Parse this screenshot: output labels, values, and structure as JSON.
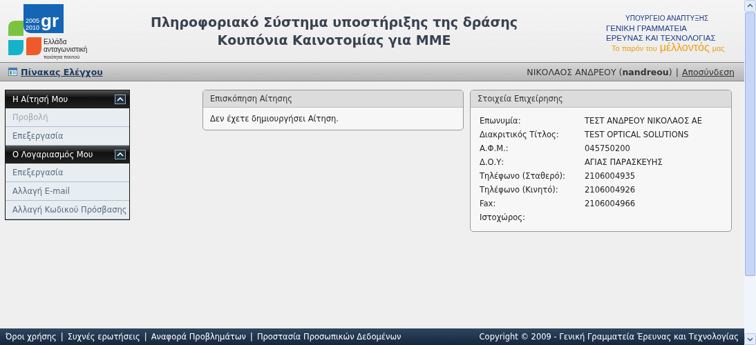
{
  "header": {
    "logo": {
      "mark": "gr",
      "years": [
        "2005",
        "2010"
      ],
      "lines": [
        "Ελλάδα",
        "ανταγωνιστική",
        "ποιότητα παντού"
      ]
    },
    "title": [
      "Πληροφοριακό Σύστημα υποστήριξης της δράσης",
      "Κουπόνια Καινοτομίας για ΜΜΕ"
    ],
    "ministry": [
      "ΥΠΟΥΡΓΕΙΟ ΑΝΑΠΤΥΞΗΣ",
      "ΓΕΝΙΚΗ ΓΡΑΜΜΑΤΕΙΑ",
      "ΕΡΕΥΝΑΣ ΚΑΙ ΤΕΧΝΟΛΟΓΙΑΣ"
    ],
    "slogan": [
      "Το παρόν του",
      "μέλλοντός",
      "μας"
    ]
  },
  "navbar": {
    "dashboard": "Πίνακας Ελέγχου",
    "user_name": "ΝΙΚΟΛΑΟΣ ΑΝΔΡΕΟΥ (**nandreou**)",
    "separator": "|",
    "logout": "Αποσύνδεση"
  },
  "sidebar": [
    {
      "title": "Η Αίτησή Μου",
      "expanded": true,
      "items": [
        {
          "label": "Προβολή",
          "disabled": true
        },
        {
          "label": "Επεξεργασία",
          "disabled": false
        }
      ]
    },
    {
      "title": "Ο Λογαριασμός Μου",
      "expanded": true,
      "items": [
        {
          "label": "Επεξεργασία",
          "disabled": false
        },
        {
          "label": "Αλλαγή E-mail",
          "disabled": false
        },
        {
          "label": "Αλλαγή Κωδικού Πρόσβασης",
          "disabled": false
        }
      ]
    }
  ],
  "overview": {
    "title": "Επισκόπηση Αίτησης",
    "message": "Δεν έχετε δημιουργήσει Αίτηση."
  },
  "business": {
    "title": "Στοιχεία Επιχείρησης",
    "fields": [
      {
        "label": "Επωνυμία:",
        "value": "ΤΕΣΤ ΑΝΔΡΕΟΥ ΝΙΚΟΛΑΟΣ ΑΕ"
      },
      {
        "label": "Διακριτικός Τίτλος:",
        "value": "TEST OPTICAL SOLUTIONS"
      },
      {
        "label": "Α.Φ.Μ.:",
        "value": "045750200"
      },
      {
        "label": "Δ.Ο.Υ:",
        "value": "ΑΓΙΑΣ ΠΑΡΑΣΚΕΥΗΣ"
      },
      {
        "label": "Τηλέφωνο (Σταθερό):",
        "value": "2106004935"
      },
      {
        "label": "Τηλέφωνο (Κινητό):",
        "value": "2106004926"
      },
      {
        "label": "Fax:",
        "value": "2106004966"
      },
      {
        "label": "Ιστοχώρος:"
      }
    ]
  },
  "footer": {
    "links": [
      "Όροι χρήσης",
      "Συχνές ερωτήσεις",
      "Αναφορά Προβλημάτων",
      "Προστασία Προσωπικών Δεδομένων"
    ],
    "separator": "|",
    "copyright": "Copyright © 2009 - Γενική Γραμματεία Έρευνας και Τεχνολογίας"
  }
}
